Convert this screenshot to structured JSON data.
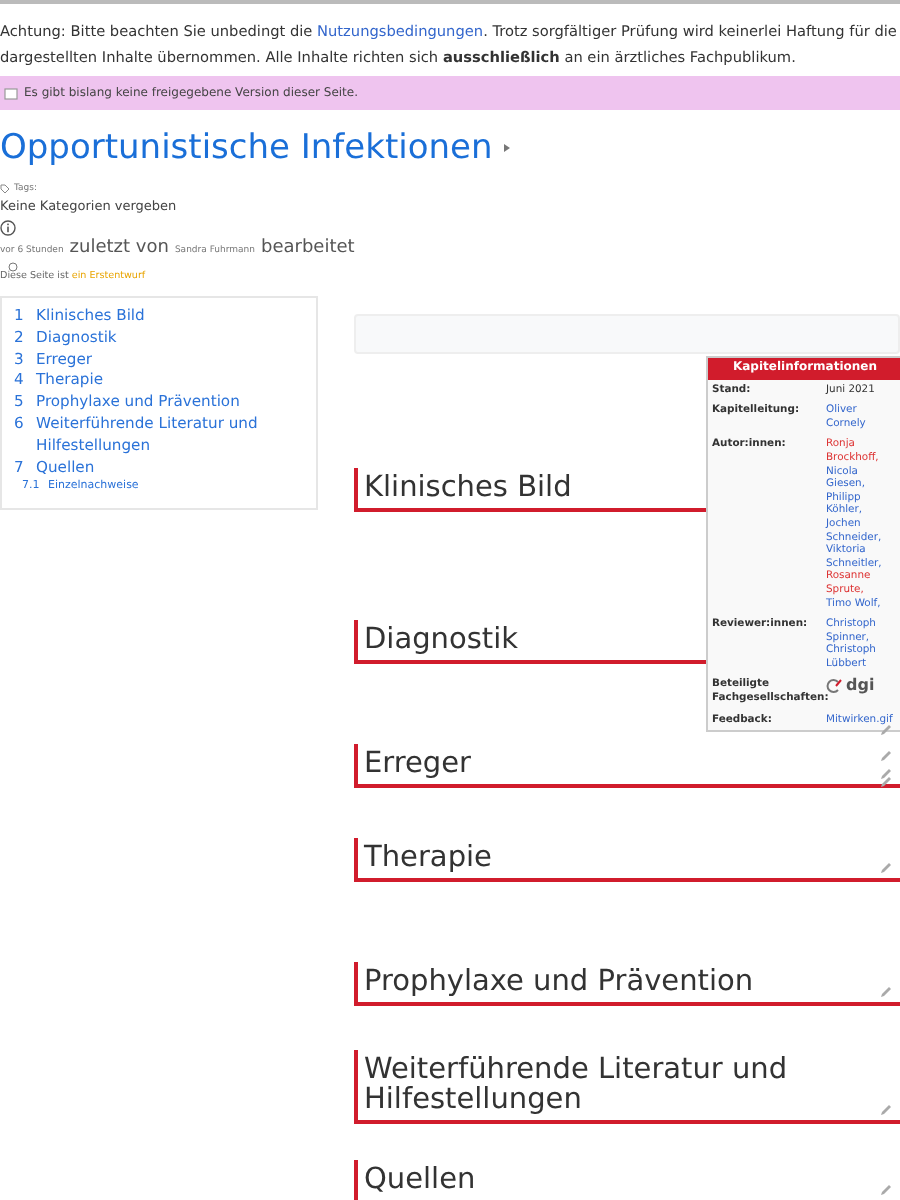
{
  "notice": {
    "text": "Achtung: Bitte beachten Sie unbedingt die ",
    "link": "Nutzungsbedingungen",
    "rest": ". Trotz sorgfältiger Prüfung wird keinerlei Haftung für die dargestellten Inhalte übernommen. Alle Inhalte richten sich **ausschließlich** an ein ärztliches Fachpublikum."
  },
  "banner": "Es gibt bislang keine freigegebene Version dieser Seite.",
  "title": "Opportunistische Infektionen",
  "tags_label": "Tags:",
  "categories": "Keine Kategorien vergeben",
  "edited": {
    "time": "vor 6 Stunden",
    "mid": "zuletzt von",
    "user": "Sandra Fuhrmann",
    "end": "bearbeitet"
  },
  "draft": {
    "text": "Diese Seite ist",
    "link": "ein Erstentwurf"
  },
  "toc": [
    {
      "number": "1",
      "label": "Klinisches Bild"
    },
    {
      "number": "2",
      "label": "Diagnostik"
    },
    {
      "number": "3",
      "label": "Erreger"
    },
    {
      "number": "4",
      "label": "Therapie"
    },
    {
      "number": "5",
      "label": "Prophylaxe und Prävention"
    },
    {
      "number": "6",
      "label": "Weiterführende Literatur und Hilfestellungen"
    },
    {
      "number": "7",
      "label": "Quellen",
      "children": [
        {
          "number": "7.1",
          "label": "Einzelnachweise"
        }
      ]
    }
  ],
  "infobox": {
    "title": "Kapitelinformationen",
    "rows": [
      {
        "label": "Stand:",
        "kind": "text",
        "value": "Juni 2021"
      },
      {
        "label": "Kapitelleitung:",
        "kind": "links",
        "names": [
          {
            "name": "Oliver Cornely",
            "color": "#3366cc"
          }
        ]
      },
      {
        "label": "Autor:innen:",
        "kind": "links",
        "names": [
          {
            "name": "Ronja Brockhoff,",
            "color": "#dd3333"
          },
          {
            "name": "Nicola Giesen,",
            "color": "#3366cc"
          },
          {
            "name": "Philipp Köhler,",
            "color": "#3366cc"
          },
          {
            "name": "Jochen Schneider,",
            "color": "#3366cc"
          },
          {
            "name": "Viktoria Schneitler,",
            "color": "#3366cc"
          },
          {
            "name": "Rosanne Sprute,",
            "color": "#dd3333"
          },
          {
            "name": "Timo Wolf,",
            "color": "#3366cc"
          }
        ]
      },
      {
        "label": "Reviewer:innen:",
        "kind": "links",
        "names": [
          {
            "name": "Christoph Spinner,",
            "color": "#3366cc"
          },
          {
            "name": "Christoph Lübbert",
            "color": "#3366cc"
          }
        ]
      },
      {
        "label": "Beteiligte Fachgesellschaften:",
        "kind": "logo",
        "value": "dgi"
      },
      {
        "label": "Feedback:",
        "kind": "links",
        "names": [
          {
            "name": "Mitwirken.gif",
            "color": "#3366cc"
          }
        ]
      }
    ]
  },
  "sections": [
    "Klinisches Bild",
    "Diagnostik",
    "Erreger",
    "Therapie",
    "Prophylaxe und Prävention",
    "Weiterführende Literatur und Hilfestellungen",
    "Quellen"
  ]
}
